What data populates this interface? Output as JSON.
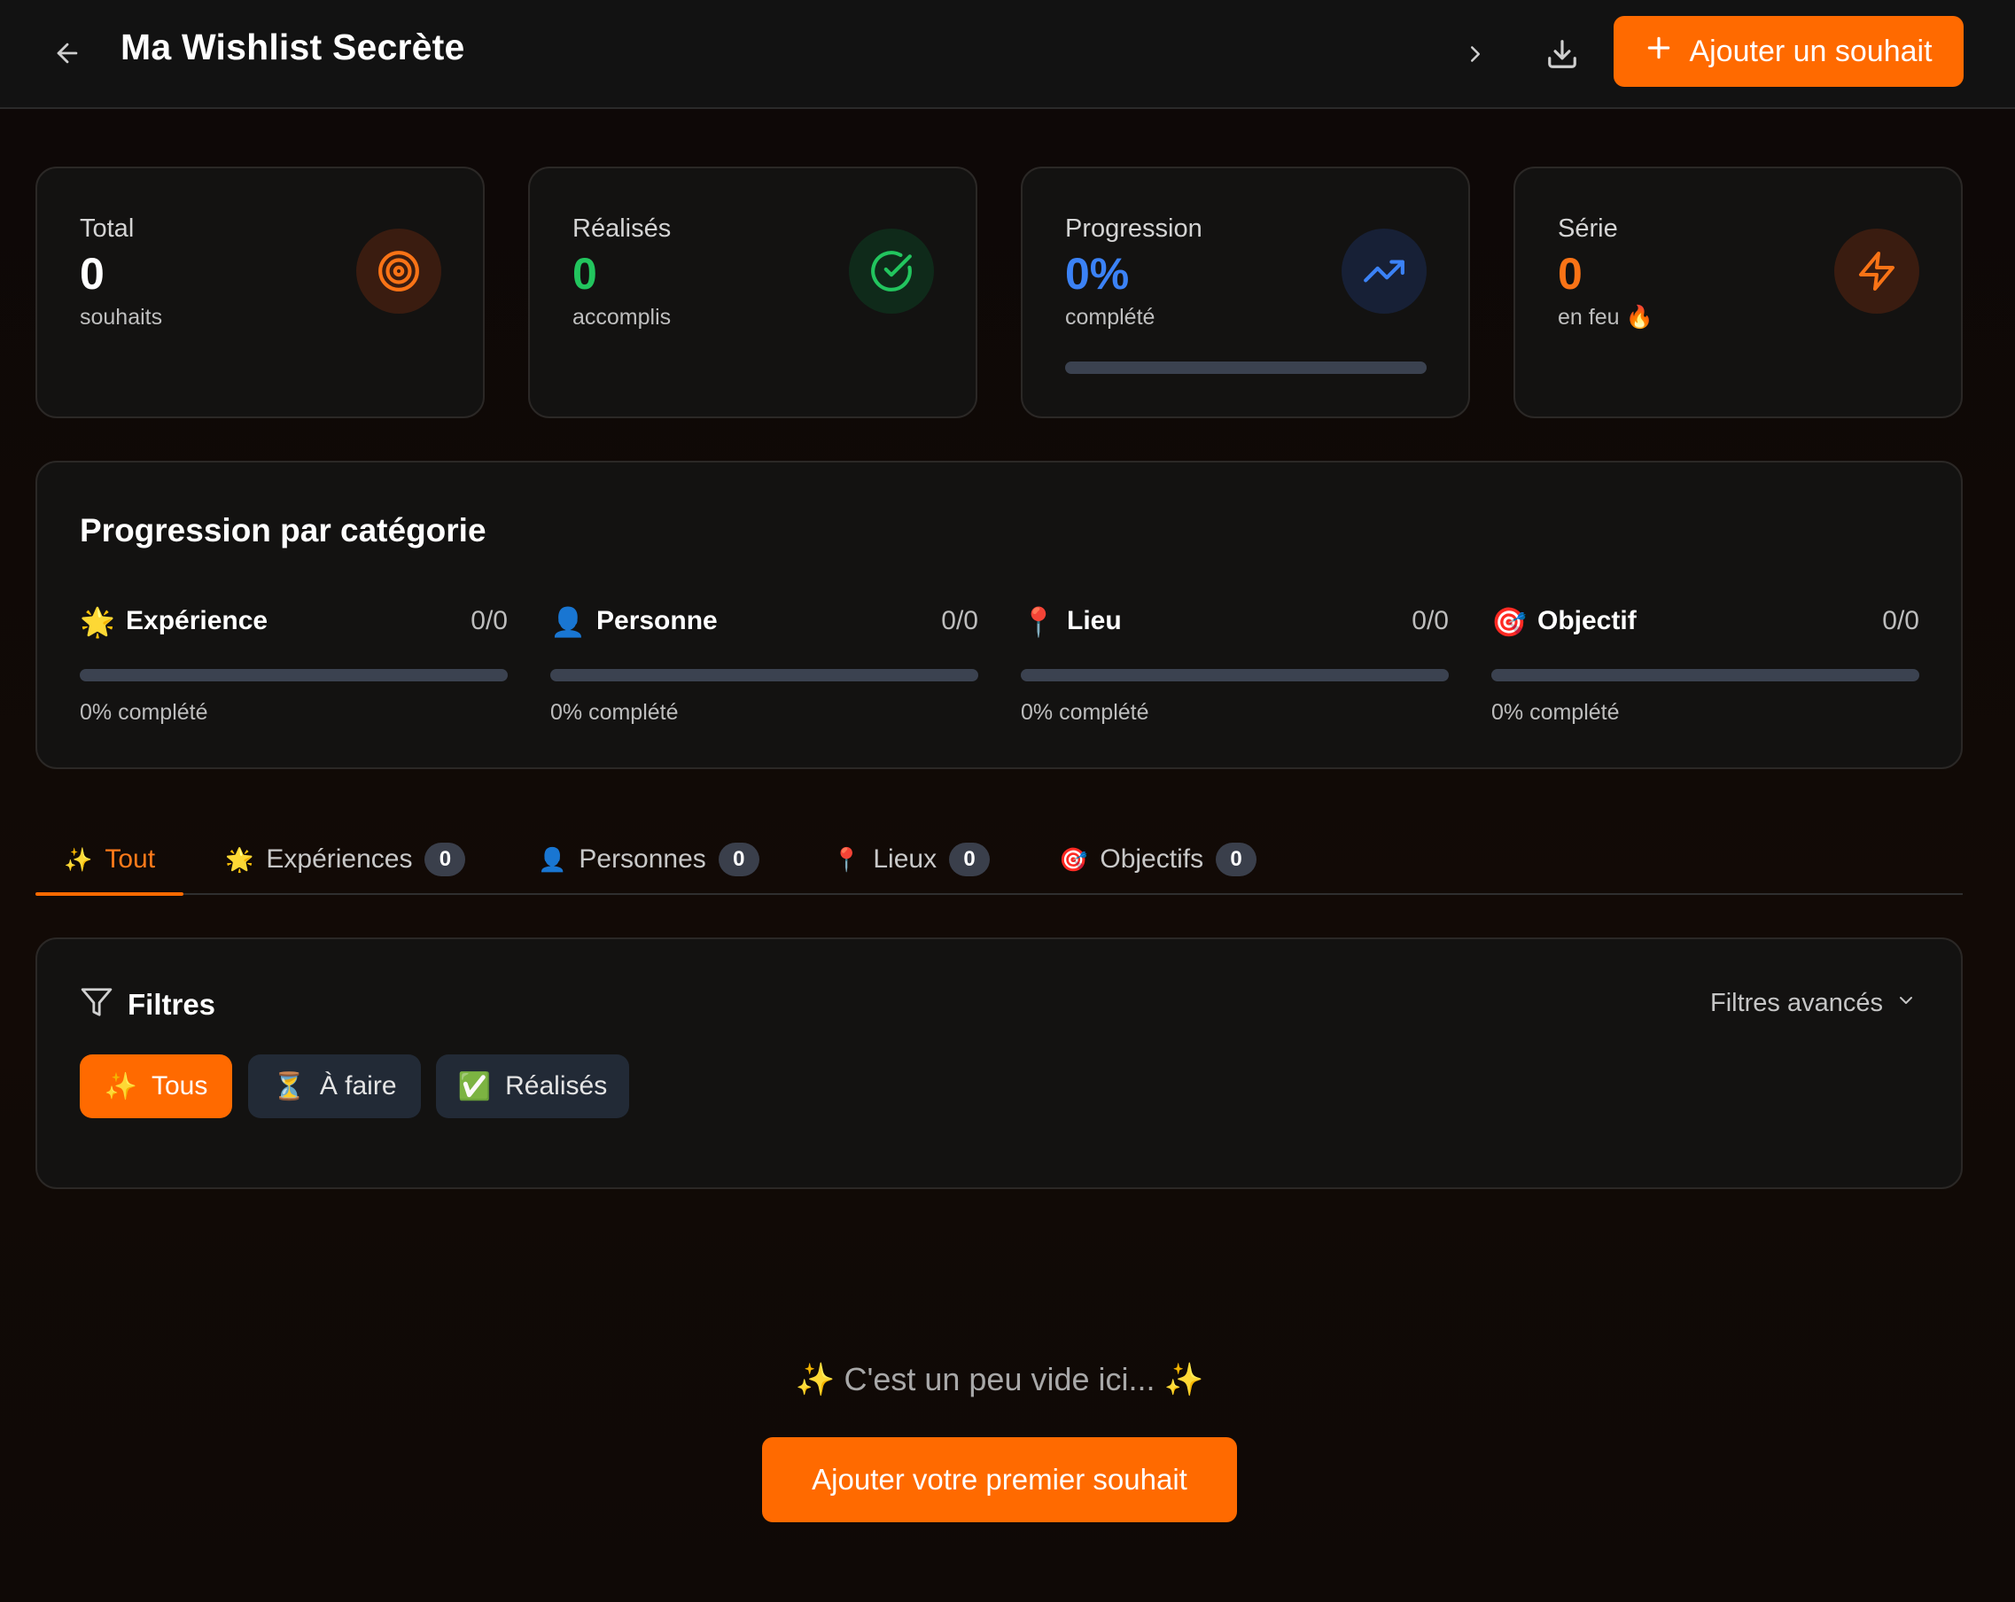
{
  "header": {
    "title": "Ma Wishlist Secrète",
    "add_button_label": "Ajouter un souhait"
  },
  "stats": [
    {
      "label": "Total",
      "value": "0",
      "sub": "souhaits",
      "icon": "target-icon",
      "color": "#ffffff",
      "icon_color": "#f97316",
      "icon_bg": "#3a1c10"
    },
    {
      "label": "Réalisés",
      "value": "0",
      "sub": "accomplis",
      "icon": "check-circle-icon",
      "color": "#22c55e",
      "icon_color": "#22c55e",
      "icon_bg": "#0f2a1a"
    },
    {
      "label": "Progression",
      "value": "0%",
      "sub": "complété",
      "icon": "trending-up-icon",
      "color": "#3b82f6",
      "icon_color": "#3b82f6",
      "icon_bg": "#172036",
      "progress": 0
    },
    {
      "label": "Série",
      "value": "0",
      "sub": "en feu 🔥",
      "icon": "lightning-icon",
      "color": "#f97316",
      "icon_color": "#f97316",
      "icon_bg": "#3a1c10"
    }
  ],
  "categories": {
    "title": "Progression par catégorie",
    "items": [
      {
        "emoji": "🌟",
        "name": "Expérience",
        "count": "0/0",
        "progress": 0,
        "pct_label": "0% complété"
      },
      {
        "emoji": "👤",
        "name": "Personne",
        "count": "0/0",
        "progress": 0,
        "pct_label": "0% complété"
      },
      {
        "emoji": "📍",
        "name": "Lieu",
        "count": "0/0",
        "progress": 0,
        "pct_label": "0% complété"
      },
      {
        "emoji": "🎯",
        "name": "Objectif",
        "count": "0/0",
        "progress": 0,
        "pct_label": "0% complété"
      }
    ]
  },
  "tabs": [
    {
      "emoji": "✨",
      "label": "Tout",
      "active": true
    },
    {
      "emoji": "🌟",
      "label": "Expériences",
      "count": "0"
    },
    {
      "emoji": "👤",
      "label": "Personnes",
      "count": "0"
    },
    {
      "emoji": "📍",
      "label": "Lieux",
      "count": "0"
    },
    {
      "emoji": "🎯",
      "label": "Objectifs",
      "count": "0"
    }
  ],
  "filters": {
    "title": "Filtres",
    "advanced_label": "Filtres avancés",
    "chips": [
      {
        "emoji": "✨",
        "label": "Tous",
        "active": true
      },
      {
        "emoji": "⏳",
        "label": "À faire"
      },
      {
        "emoji": "✅",
        "label": "Réalisés"
      }
    ]
  },
  "empty_state": {
    "message": "✨ C'est un peu vide ici... ✨",
    "button_label": "Ajouter votre premier souhait"
  },
  "colors": {
    "accent": "#ff6a00",
    "card_bg": "#131211",
    "track": "#3b4250"
  }
}
